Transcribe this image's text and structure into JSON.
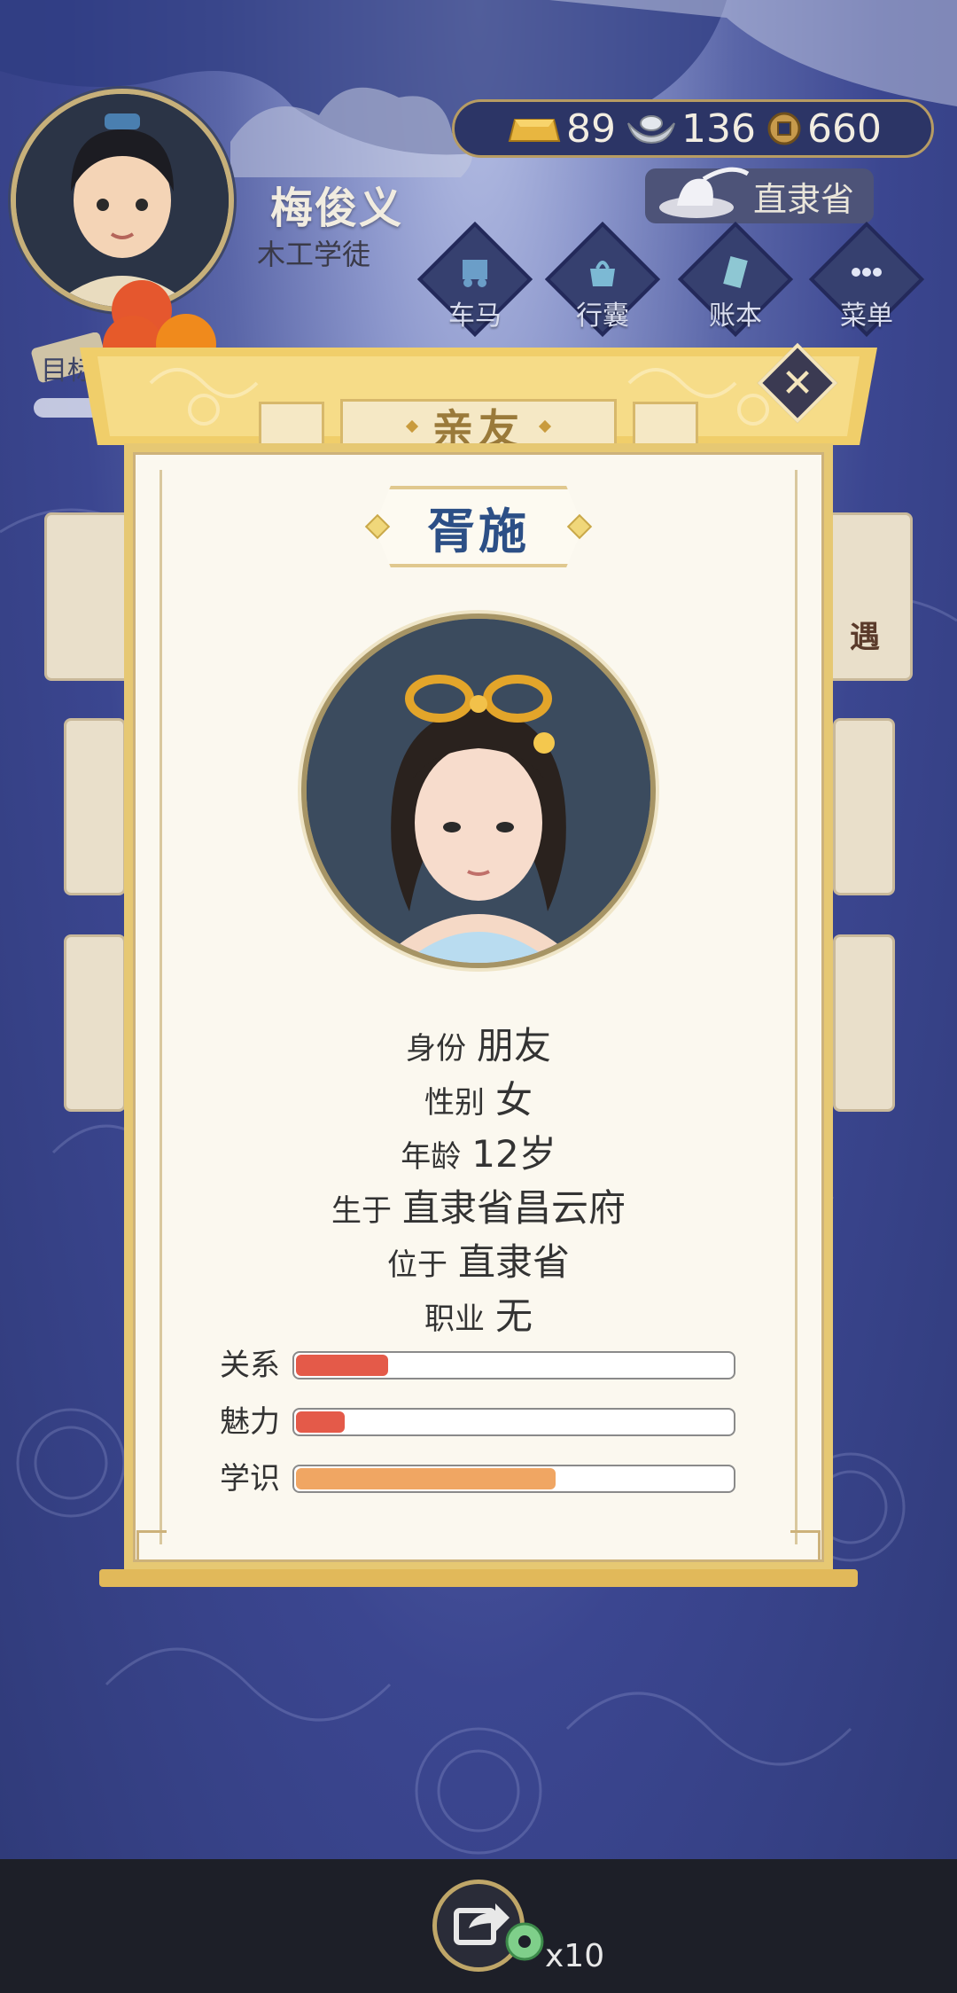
{
  "header": {
    "player_name": "梅俊义",
    "player_title": "木工学徒",
    "currency": {
      "gold": "89",
      "silver": "136",
      "coin": "660"
    },
    "location": "直隶省",
    "nav": [
      {
        "label": "车马",
        "icon": "carriage-icon"
      },
      {
        "label": "行囊",
        "icon": "bag-icon"
      },
      {
        "label": "账本",
        "icon": "ledger-icon"
      },
      {
        "label": "菜单",
        "icon": "menu-dots-icon"
      }
    ],
    "goal_label": "目标"
  },
  "background": {
    "side_text": "遇"
  },
  "modal": {
    "tab_title": "亲友",
    "name": "胥施",
    "info": [
      {
        "key": "身份",
        "value": "朋友"
      },
      {
        "key": "性别",
        "value": "女"
      },
      {
        "key": "年龄",
        "value": "12岁"
      },
      {
        "key": "生于",
        "value": "直隶省昌云府"
      },
      {
        "key": "位于",
        "value": "直隶省"
      },
      {
        "key": "职业",
        "value": "无"
      }
    ],
    "stats": [
      {
        "label": "关系",
        "level": 0.21,
        "color": "#e45a49"
      },
      {
        "label": "魅力",
        "level": 0.11,
        "color": "#e45a49"
      },
      {
        "label": "学识",
        "level": 0.59,
        "color": "#f0a663"
      }
    ],
    "close_symbol": "✕"
  },
  "bottom": {
    "share_count": "x10"
  },
  "colors": {
    "accent_gold": "#e6c873",
    "name_blue": "#2c4f86"
  }
}
